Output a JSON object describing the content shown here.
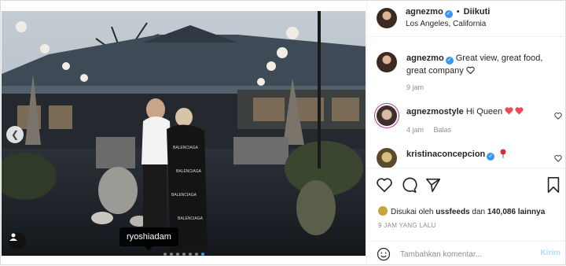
{
  "header": {
    "username": "agnezmo",
    "follow_status": "Diikuti",
    "location": "Los Angeles, California",
    "avatar_icon": "avatar-agnezmo"
  },
  "photo": {
    "tag_label": "ryoshiadam",
    "carousel": {
      "total": 7,
      "active_index": 6
    },
    "icons": {
      "prev": "chevron-left-icon",
      "tag": "user-tag-icon"
    }
  },
  "caption": {
    "username": "agnezmo",
    "text": "Great view, great food, great company ",
    "time": "9 jam"
  },
  "comments": [
    {
      "username": "agnezmostyle",
      "text": "Hi Queen ",
      "time": "4 jam",
      "reply": "Balas"
    },
    {
      "username": "kristinaconcepcion",
      "text": "",
      "time": "",
      "reply": ""
    }
  ],
  "actions": {
    "icons": [
      "heart-icon",
      "comment-icon",
      "share-icon",
      "bookmark-icon"
    ],
    "liked_prefix": "Disukai oleh",
    "liked_user": "ussfeeds",
    "liked_connector": "dan",
    "liked_count": "140,086 lainnya",
    "time_ago": "9 JAM YANG LALU"
  },
  "add_comment": {
    "placeholder": "Tambahkan komentar...",
    "post_label": "Kirim"
  },
  "colors": {
    "accent": "#3897f0",
    "post_disabled": "#b3dbff",
    "heart_red": "#ed4956",
    "muted": "#8e8e8e"
  }
}
